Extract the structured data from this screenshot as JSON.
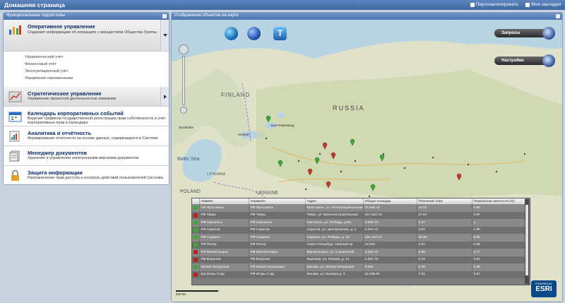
{
  "header": {
    "title": "Домашняя страница",
    "personalize": "Персонализировать",
    "bookmarks": "Мои закладки"
  },
  "left_panel": {
    "title": "Функциональные подсистемы",
    "sections": [
      {
        "title": "Оперативное управление",
        "desc": "Содержит информацию об операциях с имуществом Общества Группы",
        "subitems": [
          "Управленческий учёт",
          "Финансовый учёт",
          "Эксплуатационный учёт",
          "Управление переменными"
        ]
      },
      {
        "title": "Стратегическое управление",
        "desc": "Управление проектной деятельностью компании"
      },
      {
        "title": "Календарь корпоративных событий",
        "desc": "Ведение графиков государственной регистрации прав собственности и учёт корпоративных прав в календаре"
      },
      {
        "title": "Аналитика и отчётность",
        "desc": "Формирование отчётности на основе данных, содержащихся в Системе"
      },
      {
        "title": "Менеджер документов",
        "desc": "Хранение и управление электронными версиями документов"
      },
      {
        "title": "Защита информации",
        "desc": "Разграничение прав доступа и контроль действий пользователей Системы"
      }
    ]
  },
  "map_panel": {
    "title": "Отображение объектов на карте",
    "btn_queries": "Запросы",
    "btn_settings": "Настройки",
    "labels": {
      "finland": "FINLAND",
      "russia": "RUSSIA",
      "baltic": "Baltic Sea",
      "lithuania": "LITHUANIA",
      "poland": "POLAND",
      "ukraine": "UKRAINE",
      "stpete": "Saint Petersburg",
      "helsinki": "Helsinki",
      "stockholm": "Stockholm"
    },
    "scale_label": "500 km",
    "esri_powered": "POWERED BY",
    "esri": "ESRI"
  },
  "grid": {
    "columns": [
      "Наимен",
      "Управлен",
      "Адрес",
      "Общая площадь",
      "Полезный этаж",
      "Показатели занятости (%)"
    ],
    "rows": [
      {
        "status": "ok",
        "name": "РФ-Ярославль",
        "unit": "РФ-Ярославль",
        "address": "Ярославль, ул. Интернациональная",
        "area": "15.906.42",
        "floors": "15.51",
        "occ": "0.95"
      },
      {
        "status": "bad",
        "name": "РФ-Тверь",
        "unit": "РФ-Тверь",
        "address": "Тверь, ул. Вагонностроительная",
        "area": "237.523.73",
        "floors": "27.57",
        "occ": "0.87"
      },
      {
        "status": "ok",
        "name": "РФ-Смоленск",
        "unit": "РФ-Смоленск",
        "address": "Смоленск, ул. Победы, д.56",
        "area": "3.294.73",
        "floors": "3.47",
        "occ": "1"
      },
      {
        "status": "ok",
        "name": "РФ-Саратов",
        "unit": "РФ-Саратов",
        "address": "Саратов, ул. Центральная, д. 4",
        "area": "3.294.73",
        "floors": "3.67",
        "occ": "1.90"
      },
      {
        "status": "ok",
        "name": "РФ-Саранск",
        "unit": "РФ-Саранск",
        "address": "Саранск, ул. Победы, д. 15",
        "area": "104.143.27",
        "floors": "28.25",
        "occ": "0.96"
      },
      {
        "status": "ok",
        "name": "РФ-Питер",
        "unit": "РФ-Питер",
        "address": "Санкт-Петербург, Невский пр.",
        "area": "14.601",
        "floors": "2.61",
        "occ": "0.99"
      },
      {
        "status": "bad",
        "name": "РФ-Магнитогорск",
        "unit": "РФ-Магнитогорск",
        "address": "Магнитогорск, ул. Строителей",
        "area": "3.294.73",
        "floors": "0.69",
        "occ": "3.77"
      },
      {
        "status": "bad",
        "name": "РФ-Воронеж",
        "unit": "РФ-Воронеж",
        "address": "Воронеж, ул. Ленина, д. 13",
        "area": "3.294.73",
        "floors": "0.43",
        "occ": "0.81"
      },
      {
        "status": "ok",
        "name": "Малая Калужская",
        "unit": "РФ-Малая Калужская",
        "address": "Москва, ул. Малая Калужская",
        "area": "3.940",
        "floors": "0.49",
        "occ": "0.89"
      },
      {
        "status": "bad",
        "name": "БЦ Игорь Стар",
        "unit": "РФ-Игорь Стар",
        "address": "Москва, ул. Балашо д. 3",
        "area": "22.296.81",
        "floors": "7.93",
        "occ": "0.87"
      }
    ]
  }
}
